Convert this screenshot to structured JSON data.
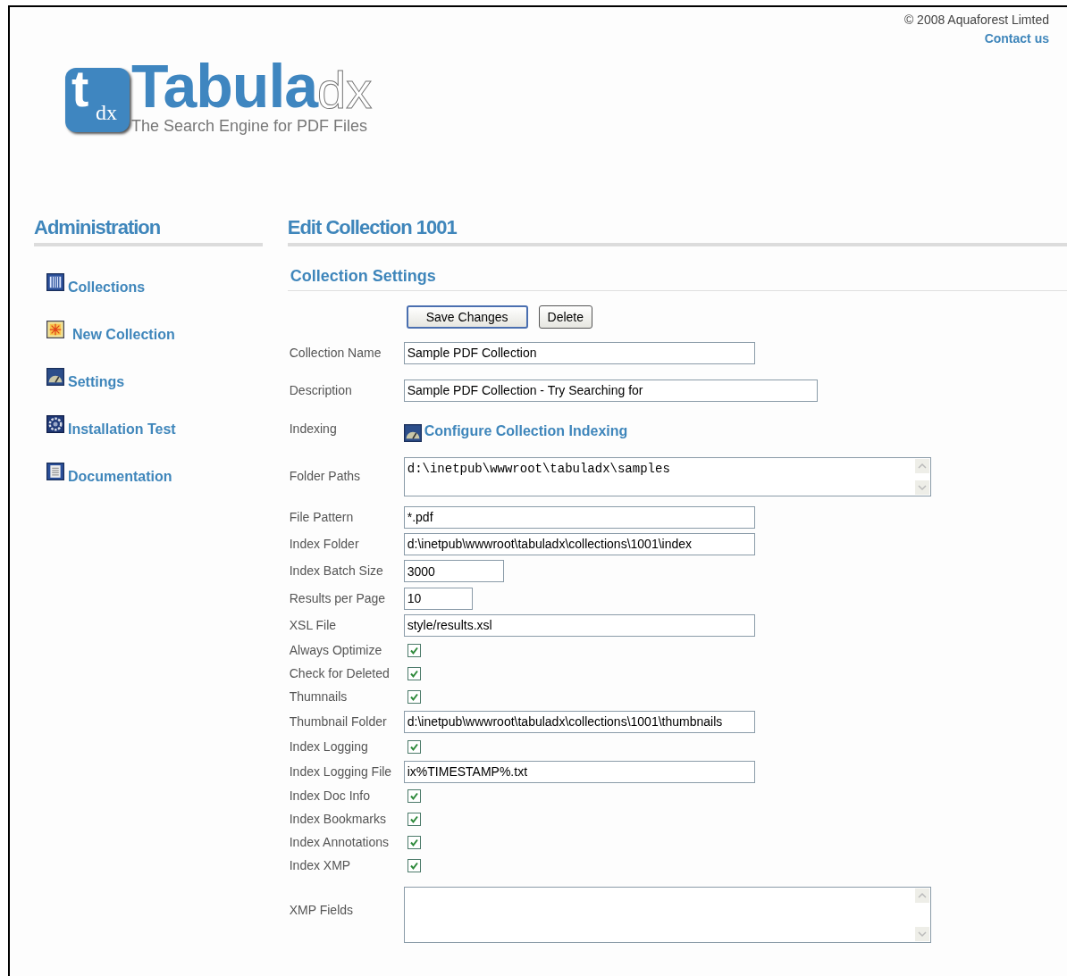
{
  "header": {
    "copyright": "© 2008 Aquaforest Limted",
    "contact_link": "Contact us"
  },
  "logo": {
    "badge_letter": "t",
    "badge_sub": "dx",
    "name": "Tabula",
    "name_suffix": "dx",
    "tagline": "The Search Engine for PDF Files"
  },
  "sidebar": {
    "title": "Administration",
    "items": [
      {
        "label": "Collections"
      },
      {
        "label": "New Collection"
      },
      {
        "label": "Settings"
      },
      {
        "label": "Installation Test"
      },
      {
        "label": "Documentation"
      }
    ]
  },
  "main": {
    "title": "Edit Collection 1001",
    "section_title": "Collection Settings",
    "buttons": [
      {
        "label": "Save Changes",
        "default": true
      },
      {
        "label": "Delete",
        "default": false
      }
    ],
    "fields": [
      {
        "kind": "text",
        "label": "Collection Name",
        "value": "Sample PDF Collection"
      },
      {
        "kind": "text",
        "label": "Description",
        "value": "Sample PDF Collection - Try Searching for"
      },
      {
        "kind": "link",
        "label": "Indexing",
        "value": "Configure Collection Indexing"
      },
      {
        "kind": "textarea",
        "label": "Folder Paths",
        "value": "d:\\inetpub\\wwwroot\\tabuladx\\samples"
      },
      {
        "kind": "text",
        "label": "File Pattern",
        "value": "*.pdf"
      },
      {
        "kind": "text",
        "label": "Index Folder",
        "value": "d:\\inetpub\\wwwroot\\tabuladx\\collections\\1001\\index"
      },
      {
        "kind": "text",
        "label": "Index Batch Size",
        "value": "3000"
      },
      {
        "kind": "text",
        "label": "Results per Page",
        "value": "10"
      },
      {
        "kind": "text",
        "label": "XSL File",
        "value": "style/results.xsl"
      },
      {
        "kind": "checkbox",
        "label": "Always Optimize",
        "checked": true
      },
      {
        "kind": "checkbox",
        "label": "Check for Deleted",
        "checked": true
      },
      {
        "kind": "checkbox",
        "label": "Thumnails",
        "checked": true
      },
      {
        "kind": "text",
        "label": "Thumbnail Folder",
        "value": "d:\\inetpub\\wwwroot\\tabuladx\\collections\\1001\\thumbnails"
      },
      {
        "kind": "checkbox",
        "label": "Index Logging",
        "checked": true
      },
      {
        "kind": "text",
        "label": "Index Logging File",
        "value": "ix%TIMESTAMP%.txt"
      },
      {
        "kind": "checkbox",
        "label": "Index Doc Info",
        "checked": true
      },
      {
        "kind": "checkbox",
        "label": "Index Bookmarks",
        "checked": true
      },
      {
        "kind": "checkbox",
        "label": "Index Annotations",
        "checked": true
      },
      {
        "kind": "checkbox",
        "label": "Index XMP",
        "checked": true
      },
      {
        "kind": "textarea",
        "label": "XMP Fields"
      }
    ]
  }
}
